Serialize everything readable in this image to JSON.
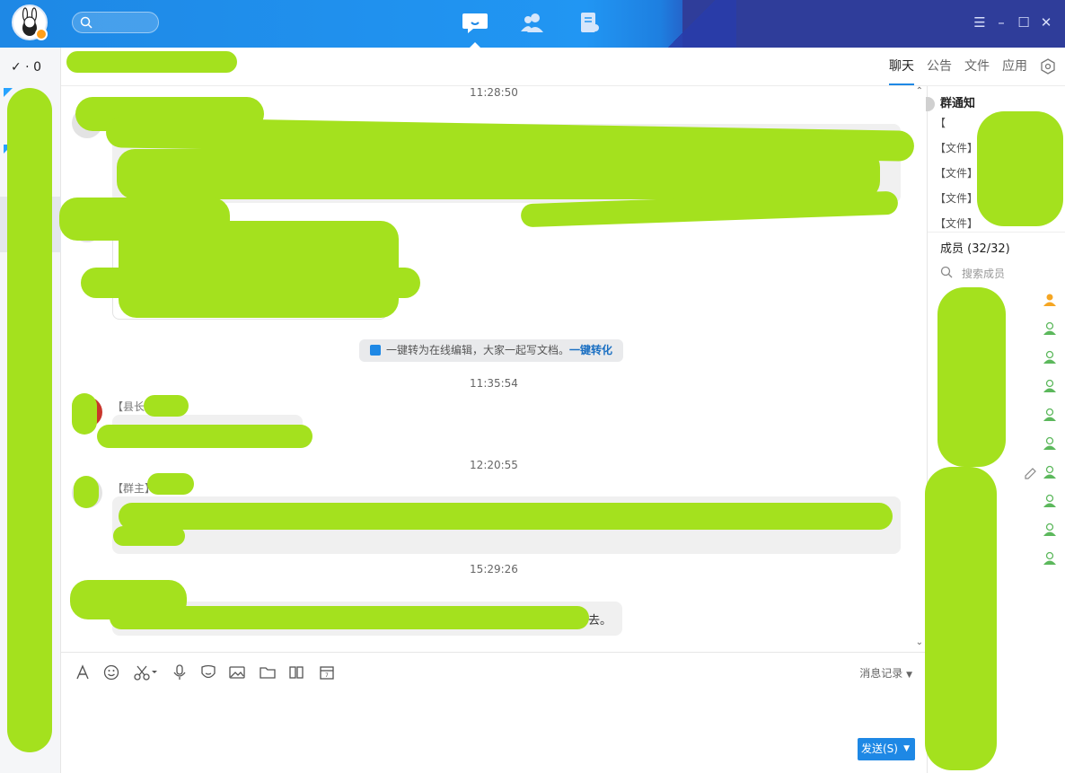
{
  "titlebar": {
    "nav": [
      {
        "name": "chat-nav-icon",
        "active": true
      },
      {
        "name": "contacts-nav-icon",
        "active": false
      },
      {
        "name": "docs-nav-icon",
        "active": false
      }
    ],
    "window_controls": [
      "☰",
      "–",
      "☐",
      "✕"
    ]
  },
  "leftbar": {
    "status": "✓ · 0"
  },
  "chat_header": {
    "tabs": [
      "聊天",
      "公告",
      "文件",
      "应用"
    ]
  },
  "messages": {
    "times": [
      "11:28:50",
      "11:35:54",
      "12:20:55",
      "15:29:26"
    ],
    "system_notice": {
      "text": "一键转为在线编辑，大家一起写文档。",
      "link": "一键转化"
    },
    "senders": [
      "【县长",
      "【群主】"
    ],
    "last_message_tail": "去。"
  },
  "compose": {
    "history_label": "消息记录",
    "send_label": "发送(S)"
  },
  "right_panel": {
    "notice_title": "群通知",
    "notices": [
      "【",
      "【文件】",
      "【文件】",
      "【文件】",
      "【文件】"
    ],
    "members_title": "成员 (32/32)",
    "member_search_placeholder": "搜索成员"
  },
  "colors": {
    "accent": "#1e88e5",
    "titlebar_dark": "#2f3d9a",
    "redaction": "#a4e11e"
  }
}
